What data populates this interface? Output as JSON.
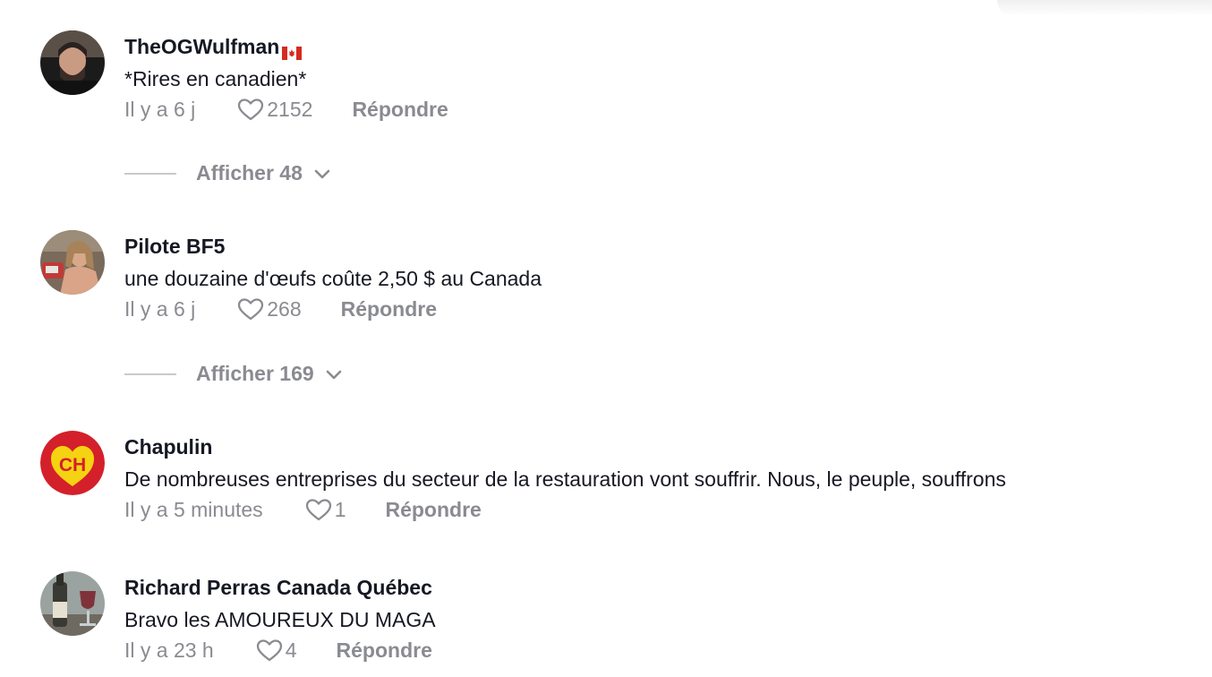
{
  "comments": [
    {
      "username": "TheOGWulfman",
      "flag": "canada-flag",
      "text": "*Rires en canadien*",
      "time": "Il y a 6 j",
      "likes": "2152",
      "reply_label": "Répondre",
      "replies_label": "Afficher 48"
    },
    {
      "username": "Pilote BF5",
      "text": "une douzaine d'œufs coûte 2,50 $ au Canada",
      "time": "Il y a 6 j",
      "likes": "268",
      "reply_label": "Répondre",
      "replies_label": "Afficher 169"
    },
    {
      "username": "Chapulin",
      "avatar_text": "CH",
      "text": "De nombreuses entreprises du secteur de la restauration vont souffrir. Nous, le peuple, souffrons",
      "time": "Il y a 5 minutes",
      "likes": "1",
      "reply_label": "Répondre"
    },
    {
      "username": "Richard Perras Canada Québec",
      "text": "Bravo les AMOUREUX DU MAGA",
      "time": "Il y a 23 h",
      "likes": "4",
      "reply_label": "Répondre"
    }
  ],
  "colors": {
    "text": "#161823",
    "secondary": "#8a8b91",
    "chapulin_red": "#d4202a",
    "chapulin_yellow": "#f5d312"
  }
}
